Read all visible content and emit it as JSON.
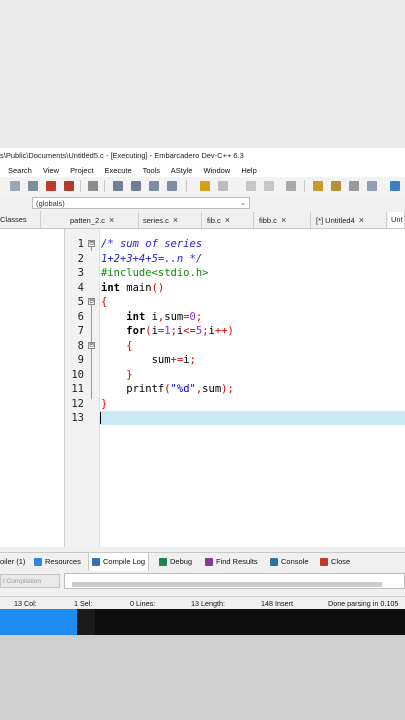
{
  "window": {
    "title": "s\\Public\\Documents\\Untitled5.c - [Executing] - Embarcadero Dev-C++ 6.3"
  },
  "menu": [
    "Search",
    "View",
    "Project",
    "Execute",
    "Tools",
    "AStyle",
    "Window",
    "Help"
  ],
  "scope": {
    "value": "(globals)"
  },
  "left_panel": {
    "tab": "Classes"
  },
  "file_tabs": [
    {
      "label": "patten_2.c",
      "active": false
    },
    {
      "label": "series.c",
      "active": false
    },
    {
      "label": "fib.c",
      "active": false
    },
    {
      "label": "fibb.c",
      "active": false
    },
    {
      "label": "[*] Untitled4",
      "active": false
    },
    {
      "label": "Unt",
      "active": true
    }
  ],
  "editor": {
    "lines": [
      {
        "n": "1",
        "fold": "⊟",
        "code": [
          {
            "t": "/* sum of series",
            "c": "cmt"
          }
        ]
      },
      {
        "n": "2",
        "fold": "",
        "code": [
          {
            "t": "1+2+3+4+5=..n */",
            "c": "cmt"
          }
        ]
      },
      {
        "n": "3",
        "fold": "",
        "code": [
          {
            "t": "#include<stdio.h>",
            "c": "pp"
          }
        ]
      },
      {
        "n": "4",
        "fold": "",
        "code": [
          {
            "t": "int",
            "c": "kw"
          },
          {
            "t": " main",
            "c": ""
          },
          {
            "t": "()",
            "c": "sym"
          }
        ]
      },
      {
        "n": "5",
        "fold": "⊟",
        "code": [
          {
            "t": "{",
            "c": "sym"
          }
        ]
      },
      {
        "n": "6",
        "fold": "",
        "code": [
          {
            "t": "    ",
            "c": ""
          },
          {
            "t": "int",
            "c": "kw"
          },
          {
            "t": " i",
            "c": ""
          },
          {
            "t": ",",
            "c": "sym"
          },
          {
            "t": "sum",
            "c": ""
          },
          {
            "t": "=",
            "c": "sym"
          },
          {
            "t": "0",
            "c": "num"
          },
          {
            "t": ";",
            "c": "sym"
          }
        ]
      },
      {
        "n": "7",
        "fold": "",
        "code": [
          {
            "t": "    ",
            "c": ""
          },
          {
            "t": "for",
            "c": "kw"
          },
          {
            "t": "(",
            "c": "sym"
          },
          {
            "t": "i",
            "c": ""
          },
          {
            "t": "=",
            "c": "sym"
          },
          {
            "t": "1",
            "c": "num"
          },
          {
            "t": ";",
            "c": "sym"
          },
          {
            "t": "i",
            "c": ""
          },
          {
            "t": "<=",
            "c": "sym"
          },
          {
            "t": "5",
            "c": "num"
          },
          {
            "t": ";",
            "c": "sym"
          },
          {
            "t": "i",
            "c": ""
          },
          {
            "t": "++)",
            "c": "sym"
          }
        ]
      },
      {
        "n": "8",
        "fold": "⊟",
        "code": [
          {
            "t": "    ",
            "c": ""
          },
          {
            "t": "{",
            "c": "sym"
          }
        ]
      },
      {
        "n": "9",
        "fold": "",
        "code": [
          {
            "t": "        sum",
            "c": ""
          },
          {
            "t": "+=",
            "c": "sym"
          },
          {
            "t": "i",
            "c": ""
          },
          {
            "t": ";",
            "c": "sym"
          }
        ]
      },
      {
        "n": "10",
        "fold": "",
        "code": [
          {
            "t": "    ",
            "c": ""
          },
          {
            "t": "}",
            "c": "sym"
          }
        ]
      },
      {
        "n": "11",
        "fold": "",
        "code": [
          {
            "t": "    printf",
            "c": ""
          },
          {
            "t": "(",
            "c": "sym"
          },
          {
            "t": "\"%d\"",
            "c": "str"
          },
          {
            "t": ",",
            "c": "sym"
          },
          {
            "t": "sum",
            "c": ""
          },
          {
            "t": ");",
            "c": "sym"
          }
        ]
      },
      {
        "n": "12",
        "fold": "",
        "code": [
          {
            "t": "}",
            "c": "sym"
          }
        ]
      },
      {
        "n": "13",
        "fold": "",
        "code": [
          {
            "t": "",
            "c": ""
          }
        ]
      }
    ]
  },
  "bottom_tabs": [
    {
      "label": "oiler (1)",
      "icon": "compiler-icon",
      "color": "#c0392b"
    },
    {
      "label": "Resources",
      "icon": "resources-icon",
      "color": "#2e86de"
    },
    {
      "label": "Compile Log",
      "icon": "compile-log-icon",
      "color": "#3b6fb6"
    },
    {
      "label": "Debug",
      "icon": "debug-icon",
      "color": "#1e8449"
    },
    {
      "label": "Find Results",
      "icon": "find-results-icon",
      "color": "#7d3c98"
    },
    {
      "label": "Console",
      "icon": "console-icon",
      "color": "#2874a6"
    },
    {
      "label": "Close",
      "icon": "close-icon",
      "color": "#c0392b"
    }
  ],
  "abort": {
    "label": "t Compilation"
  },
  "status": {
    "col": "13 Col:",
    "sel": "1 Sel:",
    "lines": "0 Lines:",
    "length": "13 Length:",
    "chars": "148 Insert",
    "message": "Done parsing in 0.105"
  },
  "colors": {
    "highlight_line": "#cbe9f4",
    "taskbar_progress": "#1e8cf0"
  }
}
